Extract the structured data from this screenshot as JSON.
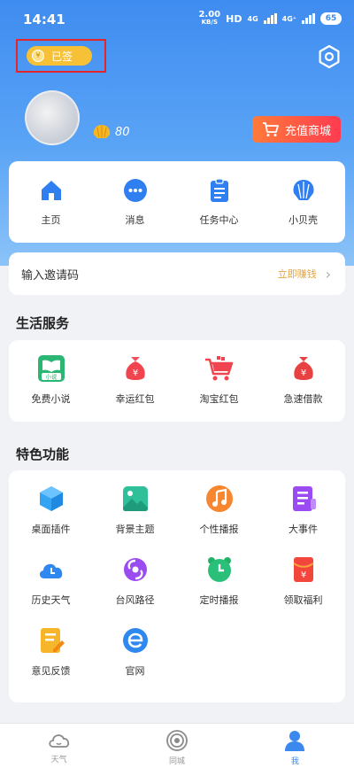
{
  "status_bar": {
    "time": "14:41",
    "speed": "2.00",
    "speed_unit": "KB/S",
    "hd": "HD",
    "net1": "4G",
    "net2": "4G⁺",
    "battery": "65"
  },
  "header": {
    "signed_label": "已签",
    "shell_count": "80",
    "shop_label": "充值商城"
  },
  "quick_menu": [
    {
      "label": "主页",
      "icon": "home-icon"
    },
    {
      "label": "消息",
      "icon": "message-icon"
    },
    {
      "label": "任务中心",
      "icon": "task-center-icon"
    },
    {
      "label": "小贝壳",
      "icon": "shell-icon"
    }
  ],
  "invite": {
    "label": "输入邀请码",
    "action": "立即赚钱"
  },
  "life": {
    "title": "生活服务",
    "items": [
      {
        "label": "免费小说",
        "icon": "novel-icon",
        "badge": "小说"
      },
      {
        "label": "幸运红包",
        "icon": "lucky-money-bag-icon"
      },
      {
        "label": "淘宝红包",
        "icon": "shopping-cart-icon"
      },
      {
        "label": "急速借款",
        "icon": "loan-money-bag-icon"
      }
    ]
  },
  "features": {
    "title": "特色功能",
    "items": [
      {
        "label": "桌面插件",
        "icon": "desktop-widget-icon"
      },
      {
        "label": "背景主题",
        "icon": "background-theme-icon"
      },
      {
        "label": "个性播报",
        "icon": "music-note-icon"
      },
      {
        "label": "大事件",
        "icon": "big-events-icon"
      },
      {
        "label": "历史天气",
        "icon": "history-weather-icon"
      },
      {
        "label": "台风路径",
        "icon": "typhoon-icon"
      },
      {
        "label": "定时播报",
        "icon": "alarm-clock-icon"
      },
      {
        "label": "领取福利",
        "icon": "red-envelope-icon"
      },
      {
        "label": "意见反馈",
        "icon": "feedback-icon"
      },
      {
        "label": "官网",
        "icon": "website-icon"
      }
    ]
  },
  "tabs": [
    {
      "label": "天气",
      "icon": "weather-cloud-icon",
      "active": false
    },
    {
      "label": "同城",
      "icon": "local-circle-icon",
      "active": false
    },
    {
      "label": "我",
      "icon": "profile-icon",
      "active": true
    }
  ],
  "colors": {
    "accent": "#3b88ee",
    "hero_top": "#3f8cf0",
    "signed_pill": "#f6c137",
    "shop_start": "#ff7b3a",
    "shop_end": "#ff3b50",
    "highlight_box": "#e2262a"
  }
}
